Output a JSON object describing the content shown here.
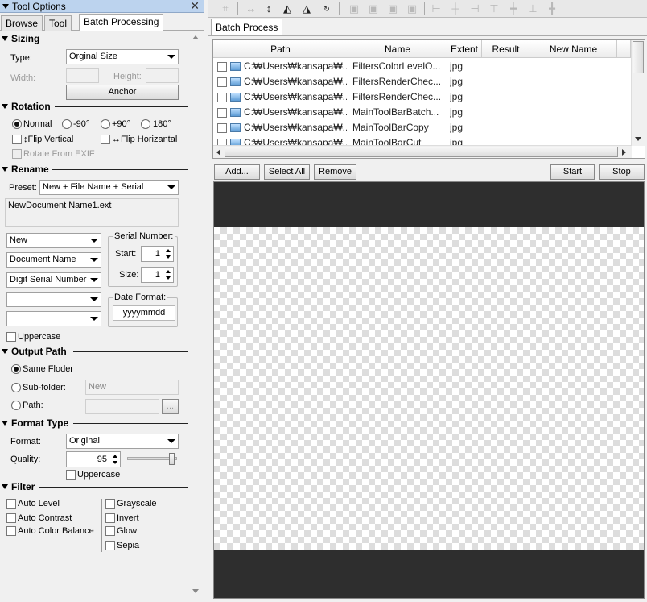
{
  "panel": {
    "title": "Tool Options",
    "close": "✕",
    "tabs": [
      "Browse",
      "Tool",
      "Batch Processing"
    ]
  },
  "sizing": {
    "title": "Sizing",
    "type_label": "Type:",
    "type_value": "Orginal Size",
    "width_label": "Width:",
    "height_label": "Height:",
    "anchor": "Anchor"
  },
  "rotation": {
    "title": "Rotation",
    "normal": "Normal",
    "r90m": "-90°",
    "r90p": "+90°",
    "r180": "180°",
    "flip_v": "↕Flip Vertical",
    "flip_h": "↔Flip Horizantal",
    "exif": "Rotate From EXIF"
  },
  "rename": {
    "title": "Rename",
    "preset_label": "Preset:",
    "preset_value": "New + File Name + Serial",
    "preview": "NewDocument Name1.ext",
    "combo1": "New",
    "combo2": "Document Name",
    "combo3": "Digit Serial Number",
    "combo4": "",
    "combo5": "",
    "serial_title": "Serial Number:",
    "start_label": "Start:",
    "start_value": "1",
    "size_label": "Size:",
    "size_value": "1",
    "date_title": "Date Format:",
    "date_value": "yyyymmdd",
    "uppercase": "Uppercase"
  },
  "output": {
    "title": "Output Path",
    "same": "Same Floder",
    "sub": "Sub-folder:",
    "sub_value": "New",
    "path": "Path:",
    "browse": "..."
  },
  "format": {
    "title": "Format Type",
    "format_label": "Format:",
    "format_value": "Original",
    "quality_label": "Quality:",
    "quality_value": "95",
    "quality_pct": 0.95,
    "uppercase": "Uppercase"
  },
  "filter": {
    "title": "Filter",
    "auto_level": "Auto Level",
    "auto_contrast": "Auto Contrast",
    "auto_color": "Auto Color Balance",
    "grayscale": "Grayscale",
    "invert": "Invert",
    "glow": "Glow",
    "sepia": "Sepia"
  },
  "batch": {
    "tab": "Batch Process",
    "columns": [
      "Path",
      "Name",
      "Extent",
      "Result",
      "New Name"
    ],
    "rows": [
      {
        "path": "C:₩Users₩kansapa₩...",
        "name": "FiltersColorLevelO...",
        "ext": "jpg"
      },
      {
        "path": "C:₩Users₩kansapa₩...",
        "name": "FiltersRenderChec...",
        "ext": "jpg"
      },
      {
        "path": "C:₩Users₩kansapa₩...",
        "name": "FiltersRenderChec...",
        "ext": "jpg"
      },
      {
        "path": "C:₩Users₩kansapa₩...",
        "name": "MainToolBarBatch...",
        "ext": "jpg"
      },
      {
        "path": "C:₩Users₩kansapa₩...",
        "name": "MainToolBarCopy",
        "ext": "jpg"
      },
      {
        "path": "C:₩Users₩kansapa₩...",
        "name": "MainToolBarCut",
        "ext": "jpg"
      }
    ],
    "add": "Add...",
    "select_all": "Select All",
    "remove": "Remove",
    "start": "Start",
    "stop": "Stop"
  }
}
